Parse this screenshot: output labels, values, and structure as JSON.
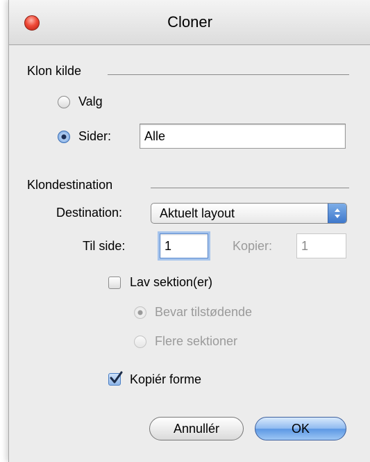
{
  "window": {
    "title": "Cloner"
  },
  "source": {
    "heading": "Klon kilde",
    "radio_selection": "Valg",
    "radio_pages": "Sider:",
    "pages_value": "Alle"
  },
  "destination": {
    "heading": "Klondestination",
    "destination_label": "Destination:",
    "destination_value": "Aktuelt layout",
    "to_page_label": "Til side:",
    "to_page_value": "1",
    "copies_label": "Kopier:",
    "copies_value": "1",
    "make_sections_label": "Lav sektion(er)",
    "make_sections_checked": false,
    "keep_adjacent_label": "Bevar tilstødende",
    "multiple_sections_label": "Flere sektioner",
    "copy_shapes_label": "Kopiér forme",
    "copy_shapes_checked": true
  },
  "buttons": {
    "cancel": "Annullér",
    "ok": "OK"
  }
}
